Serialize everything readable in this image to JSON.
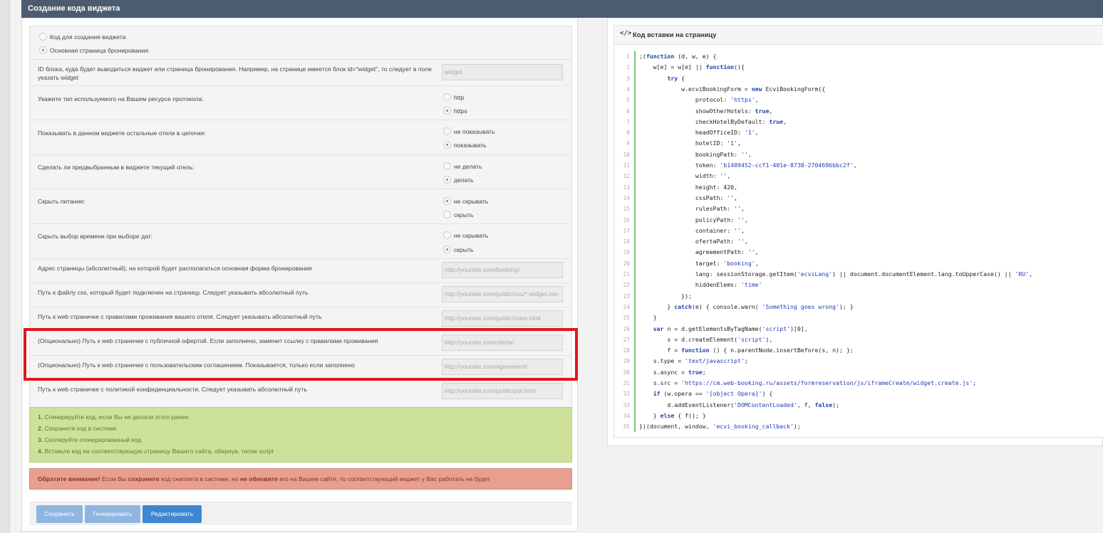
{
  "header": {
    "title": "Создание кода виджета"
  },
  "mode_options": [
    {
      "label": "Код для создания виджета",
      "selected": false
    },
    {
      "label": "Основная страница бронирования",
      "selected": true
    }
  ],
  "rows": {
    "block_id": {
      "label": "ID блока, куда будет выводиться виджет или страница бронирования. Например, на странице имеется блок id=\"widget\", то следует в поле указать widget",
      "placeholder": "widget"
    },
    "protocol": {
      "label": "Укажите тип используемого на Вашем ресурсе протокола:",
      "options": [
        {
          "label": "http",
          "selected": false
        },
        {
          "label": "https",
          "selected": true
        }
      ]
    },
    "other_hotels": {
      "label": "Показывать в данном виджете остальные отели в цепочке:",
      "options": [
        {
          "label": "не показывать",
          "selected": false
        },
        {
          "label": "показывать",
          "selected": true
        }
      ]
    },
    "preselect": {
      "label": "Сделать ли предвыбранным в виджете текущий отель:",
      "options": [
        {
          "label": "не делать",
          "selected": false
        },
        {
          "label": "делать",
          "selected": true
        }
      ]
    },
    "hide_food": {
      "label": "Скрыть питание:",
      "options": [
        {
          "label": "не скрывать",
          "selected": true
        },
        {
          "label": "скрыть",
          "selected": false
        }
      ]
    },
    "hide_time": {
      "label": "Скрыть выбор времени при выборе дат:",
      "options": [
        {
          "label": "не скрывать",
          "selected": false
        },
        {
          "label": "скрыть",
          "selected": true
        }
      ]
    },
    "booking_url": {
      "label": "Адрес страницы (абсолютный), на которой будет располагаться основная форма бронирования",
      "placeholder": "http://yoursite.com/booking/"
    },
    "css_path": {
      "label": "Путь к файлу css, который будет подключен на страницу. Следует указывать абсолютный путь",
      "placeholder": "http://yoursite.com/public/css/*.widget.min"
    },
    "rules_path": {
      "label": "Путь к web страничке с правилами проживания вашего отеля. Следует указывать абсолютный путь",
      "placeholder": "http://yoursite.com/public/rules.html"
    },
    "oferta_path": {
      "label": "(Опционально) Путь к web страничке с публичной офертой. Если заполнено, заменит ссылку с правилами проживания",
      "placeholder": "http://yoursite.com/oferta/"
    },
    "agreement_path": {
      "label": "(Опционально) Путь к web страничке с пользовательским соглашением. Показывается, только если заполнено",
      "placeholder": "http://yoursite.com/agreement/"
    },
    "policy_path": {
      "label": "Путь к web страничке с политикой конфиденциальности. Следует указывать абсолютный путь",
      "placeholder": "http://yoursite.com/public/pol.html"
    }
  },
  "steps": [
    {
      "num": "1.",
      "text": " Сгенерируйте код, если Вы не делали этого ранее"
    },
    {
      "num": "2.",
      "text": " Сохраните код в системе"
    },
    {
      "num": "3.",
      "text": " Скопируйте сгенерированный код"
    },
    {
      "num": "4.",
      "text": " Вставьте код на соответствующую страницу Вашего сайта, обернув, тегом script"
    }
  ],
  "warning": {
    "strong1": "Обратите внимание!",
    "t1": " Если Вы ",
    "strong2": "сохраните",
    "t2": " код сниппета в системе, но ",
    "strong3": "не обновите",
    "t3": " его на Вашем сайте, то соответствующий виджет у Вас работать не будет"
  },
  "buttons": {
    "save": "Сохранить",
    "generate": "Генерировать",
    "edit": "Редактировать"
  },
  "code_panel": {
    "icon": "code-icon",
    "title": "Код вставки на страницу",
    "lines": [
      ";(function (d, w, e) {",
      "    w[e] = w[e] || function(){",
      "        try {",
      "            w.ecviBookingForm = new EcviBookingForm({",
      "                protocol: 'https',",
      "                showOtherHotels: true,",
      "                checkHotelByDefault: true,",
      "                headOfficeID: '1',",
      "                hotelID: '1',",
      "                bookingPath: '',",
      "                token: 'b1409452-ccf1-401e-8738-2704696bbc2f',",
      "                width: '',",
      "                height: 420,",
      "                cssPath: '',",
      "                rulesPath: '',",
      "                policyPath: '',",
      "                container: '',",
      "                ofertaPath: '',",
      "                agreementPath: '',",
      "                target: 'booking',",
      "                lang: sessionStorage.getItem('ecviLang') || document.documentElement.lang.toUpperCase() || 'RU',",
      "                hiddenElems: 'time'",
      "            });",
      "        } catch(e) { console.warn( 'Something goes wrong'); }",
      "    }",
      "    var n = d.getElementsByTagName('script')[0],",
      "        s = d.createElement('script'),",
      "        f = function () { n.parentNode.insertBefore(s, n); };",
      "    s.type = 'text/javascript';",
      "    s.async = true;",
      "    s.src = 'https://cm.web-booking.ru/assets/formreservation/js/iframeCreate/widget.create.js';",
      "    if (w.opera == '[object Opera]') {",
      "        d.addEventListener('DOMContentLoaded', f, false);",
      "    } else { f(); }",
      "})(document, window, 'ecvi_booking_callback');"
    ]
  },
  "colors": {
    "header_bg": "#4c5c70",
    "highlight": "#e0171c",
    "hint_bg": "#cde19a",
    "warn_bg": "#e7a08f",
    "primary_btn": "#3f86d0"
  }
}
